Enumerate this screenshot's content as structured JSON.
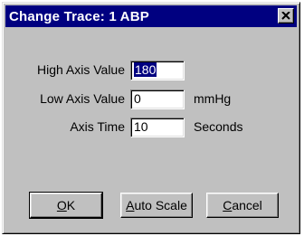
{
  "window": {
    "title": "Change Trace: 1  ABP",
    "close_icon": "close-icon"
  },
  "form": {
    "high_axis": {
      "label": "High Axis Value",
      "value": "180"
    },
    "low_axis": {
      "label": "Low Axis Value",
      "value": "0",
      "unit": "mmHg"
    },
    "axis_time": {
      "label": "Axis Time",
      "value": "10",
      "unit": "Seconds"
    }
  },
  "buttons": {
    "ok": {
      "mnemonic": "O",
      "rest": "K"
    },
    "auto_scale": {
      "mnemonic": "A",
      "rest": "uto Scale"
    },
    "cancel": {
      "mnemonic": "C",
      "rest": "ancel"
    }
  },
  "colors": {
    "titlebar": "#000080",
    "dialog_face": "#c0c0c0",
    "selection": "#000080"
  }
}
